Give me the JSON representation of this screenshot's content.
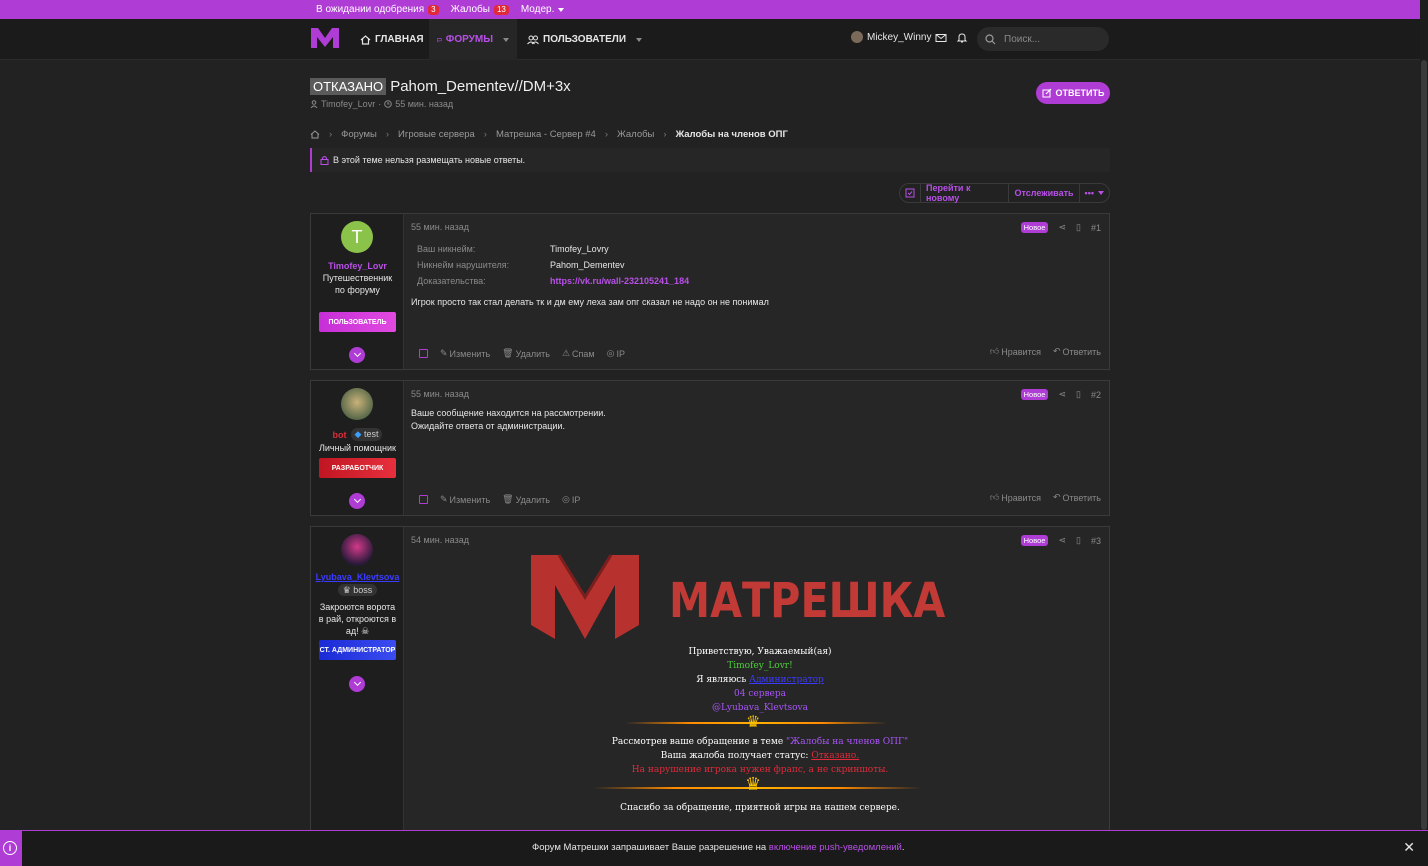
{
  "topbar": {
    "pending_label": "В ожидании одобрения",
    "pending_count": "3",
    "complaints_label": "Жалобы",
    "complaints_count": "13",
    "moder_label": "Модер."
  },
  "nav": {
    "home": "ГЛАВНАЯ",
    "forums": "ФОРУМЫ",
    "users": "ПОЛЬЗОВАТЕЛИ",
    "username": "Mickey_Winny",
    "search_placeholder": "Поиск..."
  },
  "thread": {
    "status_label": "ОТКАЗАНО",
    "title": "Pahom_Dementev//DM+3x",
    "author": "Timofey_Lovr",
    "time": "55 мин. назад",
    "reply_button": "ОТВЕТИТЬ"
  },
  "breadcrumbs": [
    "Форумы",
    "Игровые сервера",
    "Матрешка - Сервер #4",
    "Жалобы",
    "Жалобы на членов ОПГ"
  ],
  "notice": "В этой теме нельзя размещать новые ответы.",
  "toolbar": {
    "go_new": "Перейти к новому",
    "watch": "Отслеживать",
    "more": "•••"
  },
  "posts": [
    {
      "author": "Timofey_Lovr",
      "user_title": "Путешественник по форуму",
      "banner": "ПОЛЬЗОВАТЕЛЬ",
      "avatar_letter": "T",
      "time": "55 мин. назад",
      "badge": "Новое",
      "num": "#1",
      "fields": [
        {
          "k": "Ваш никнейм:",
          "v": "Timofey_Lovry"
        },
        {
          "k": "Никнейм нарушителя:",
          "v": "Pahom_Dementev"
        },
        {
          "k": "Доказательства:",
          "v": "https://vk.ru/wall-232105241_184"
        }
      ],
      "message": "Игрок просто так стал делать тк и дм ему леха зам опг сказал не надо он не понимал",
      "actions": [
        "Изменить",
        "Удалить",
        "Спам",
        "IP"
      ],
      "ractions": [
        "Нравится",
        "Ответить"
      ]
    },
    {
      "author": "bot",
      "tag": "test",
      "user_title": "Личный помощник",
      "banner": "РАЗРАБОТЧИК",
      "time": "55 мин. назад",
      "badge": "Новое",
      "num": "#2",
      "message1": "Ваше сообщение находится на рассмотрении.",
      "message2": "Ожидайте ответа от администрации.",
      "actions": [
        "Изменить",
        "Удалить",
        "IP"
      ],
      "ractions": [
        "Нравится",
        "Ответить"
      ]
    },
    {
      "author": "Lyubava_Klevtsova",
      "tag": "boss",
      "user_title": "Закроются ворота в рай, откроются в ад! ☠",
      "banner": "СТ. АДМИНИСТРАТОР",
      "time": "54 мин. назад",
      "badge": "Новое",
      "num": "#3",
      "logo_text": "МАТРЕШКА",
      "l1": "Приветствую, Уважаемый(ая)",
      "l2": "Timofey_Lovr!",
      "l3a": "Я являюсь",
      "l3b": "Администратор",
      "l4": "04 сервера",
      "l5": "@Lyubava_Klevtsova",
      "l6a": "Рассмотрев ваше обращение в теме",
      "l6b": "\"Жалобы на членов ОПГ\"",
      "l7a": "Ваша жалоба получает статус:",
      "l7b": "Отказано.",
      "l8": "На нарушение игрока нужен фрапс, а не скриншоты.",
      "l9": "Спасибо за обращение, приятной игры на нашем сервере."
    }
  ],
  "push": {
    "text": "Форум Матрешки запрашивает Ваше разрешение на",
    "link": "включение push-уведомлений",
    "end": "."
  },
  "colors": {
    "accent": "#b03cd6",
    "red": "#e02a3a",
    "green": "#4cd137",
    "blue": "#3b3bff"
  }
}
